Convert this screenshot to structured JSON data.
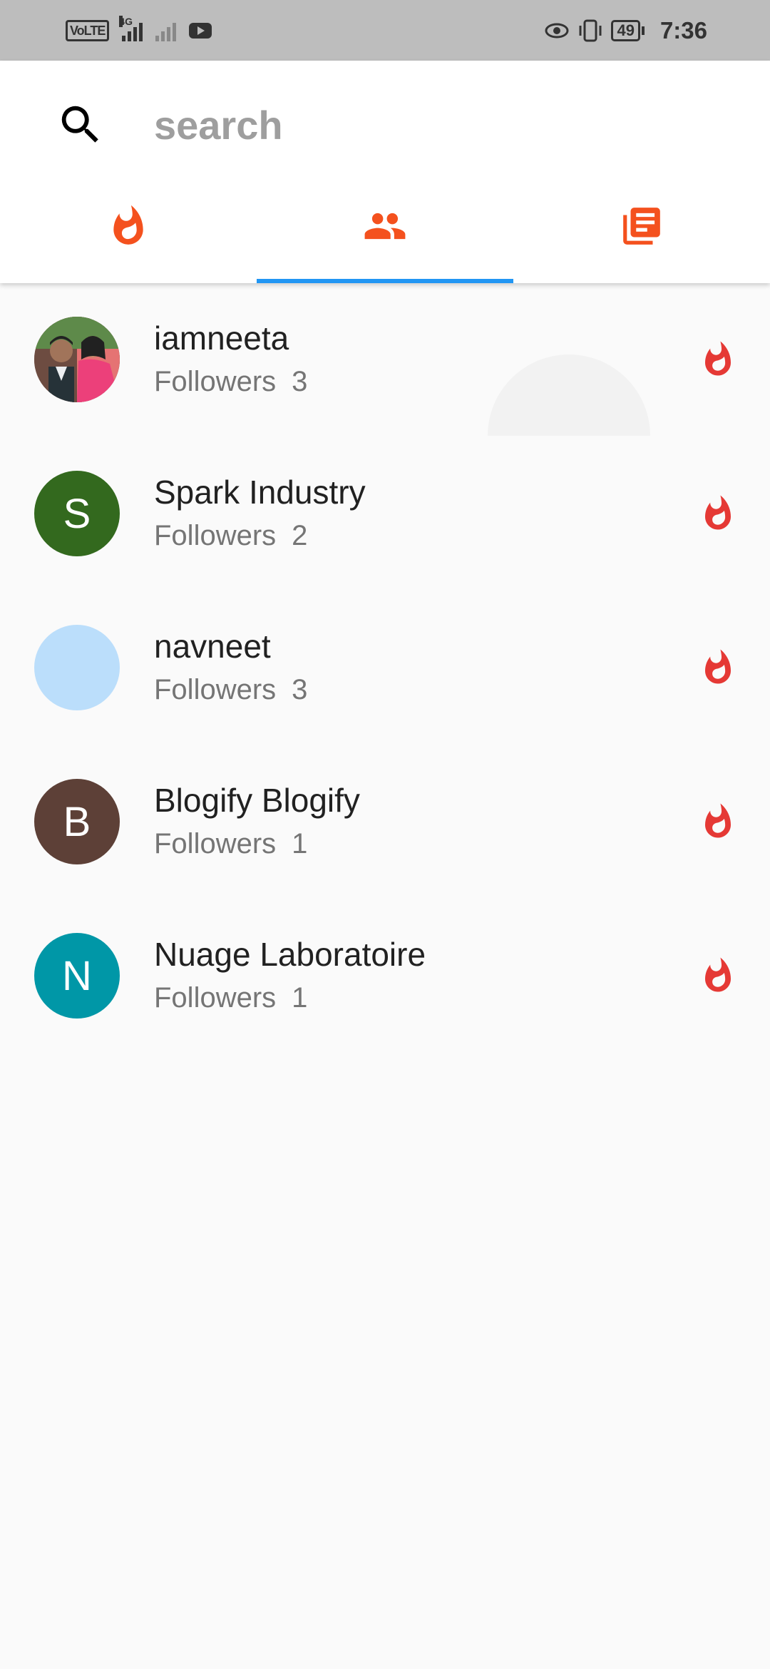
{
  "status_bar": {
    "volte": "VoLTE",
    "network": "4G",
    "battery": "49",
    "time": "7:36"
  },
  "search": {
    "placeholder": "search",
    "value": ""
  },
  "tabs": [
    {
      "icon": "fire-icon",
      "active": false
    },
    {
      "icon": "people-icon",
      "active": true
    },
    {
      "icon": "articles-icon",
      "active": false
    }
  ],
  "colors": {
    "accent": "#f4511e",
    "indicator": "#2196f3",
    "fire_list": "#e53935"
  },
  "users": [
    {
      "name": "iamneeta",
      "followers_label": "Followers",
      "followers": "3",
      "avatar_letter": "",
      "avatar_color": "#8d6e63",
      "avatar_type": "photo"
    },
    {
      "name": "Spark Industry",
      "followers_label": "Followers",
      "followers": "2",
      "avatar_letter": "S",
      "avatar_color": "#33691e",
      "avatar_type": "letter"
    },
    {
      "name": "navneet",
      "followers_label": "Followers",
      "followers": "3",
      "avatar_letter": "",
      "avatar_color": "#bbdefb",
      "avatar_type": "blank"
    },
    {
      "name": "Blogify Blogify",
      "followers_label": "Followers",
      "followers": "1",
      "avatar_letter": "B",
      "avatar_color": "#5d4037",
      "avatar_type": "letter"
    },
    {
      "name": "Nuage Laboratoire",
      "followers_label": "Followers",
      "followers": "1",
      "avatar_letter": "N",
      "avatar_color": "#0097a7",
      "avatar_type": "letter"
    }
  ]
}
